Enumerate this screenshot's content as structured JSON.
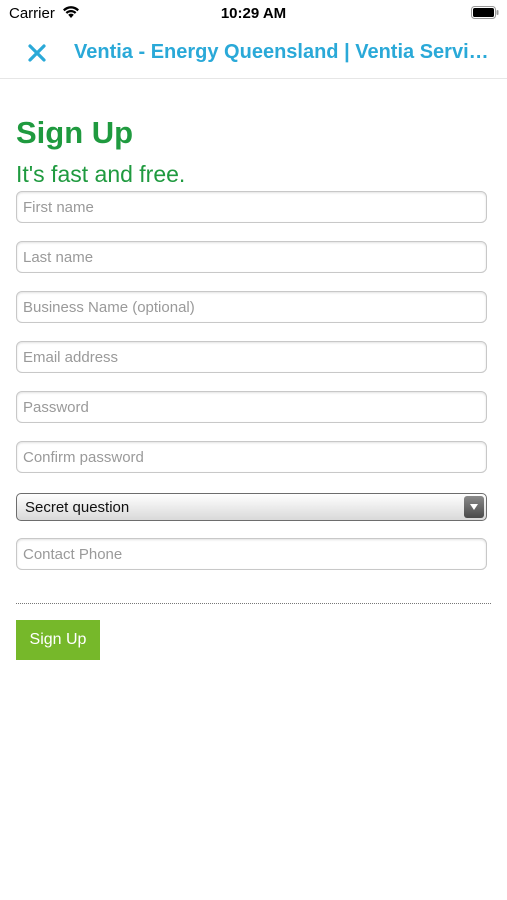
{
  "status_bar": {
    "carrier": "Carrier",
    "time": "10:29 AM"
  },
  "nav": {
    "title": "Ventia - Energy Queensland | Ventia Services",
    "close_icon": "close-icon",
    "accent_color": "#2aa9d8"
  },
  "form": {
    "title": "Sign Up",
    "subtitle": "It's fast and free.",
    "fields": {
      "first_name": {
        "placeholder": "First name",
        "value": ""
      },
      "last_name": {
        "placeholder": "Last name",
        "value": ""
      },
      "business_name": {
        "placeholder": "Business Name (optional)",
        "value": ""
      },
      "email": {
        "placeholder": "Email address",
        "value": ""
      },
      "password": {
        "placeholder": "Password",
        "value": ""
      },
      "confirm_password": {
        "placeholder": "Confirm password",
        "value": ""
      },
      "secret_question": {
        "selected": "Secret question"
      },
      "contact_phone": {
        "placeholder": "Contact Phone",
        "value": ""
      }
    },
    "submit_label": "Sign Up",
    "title_color": "#1f9a3f",
    "button_color": "#76b82a"
  }
}
